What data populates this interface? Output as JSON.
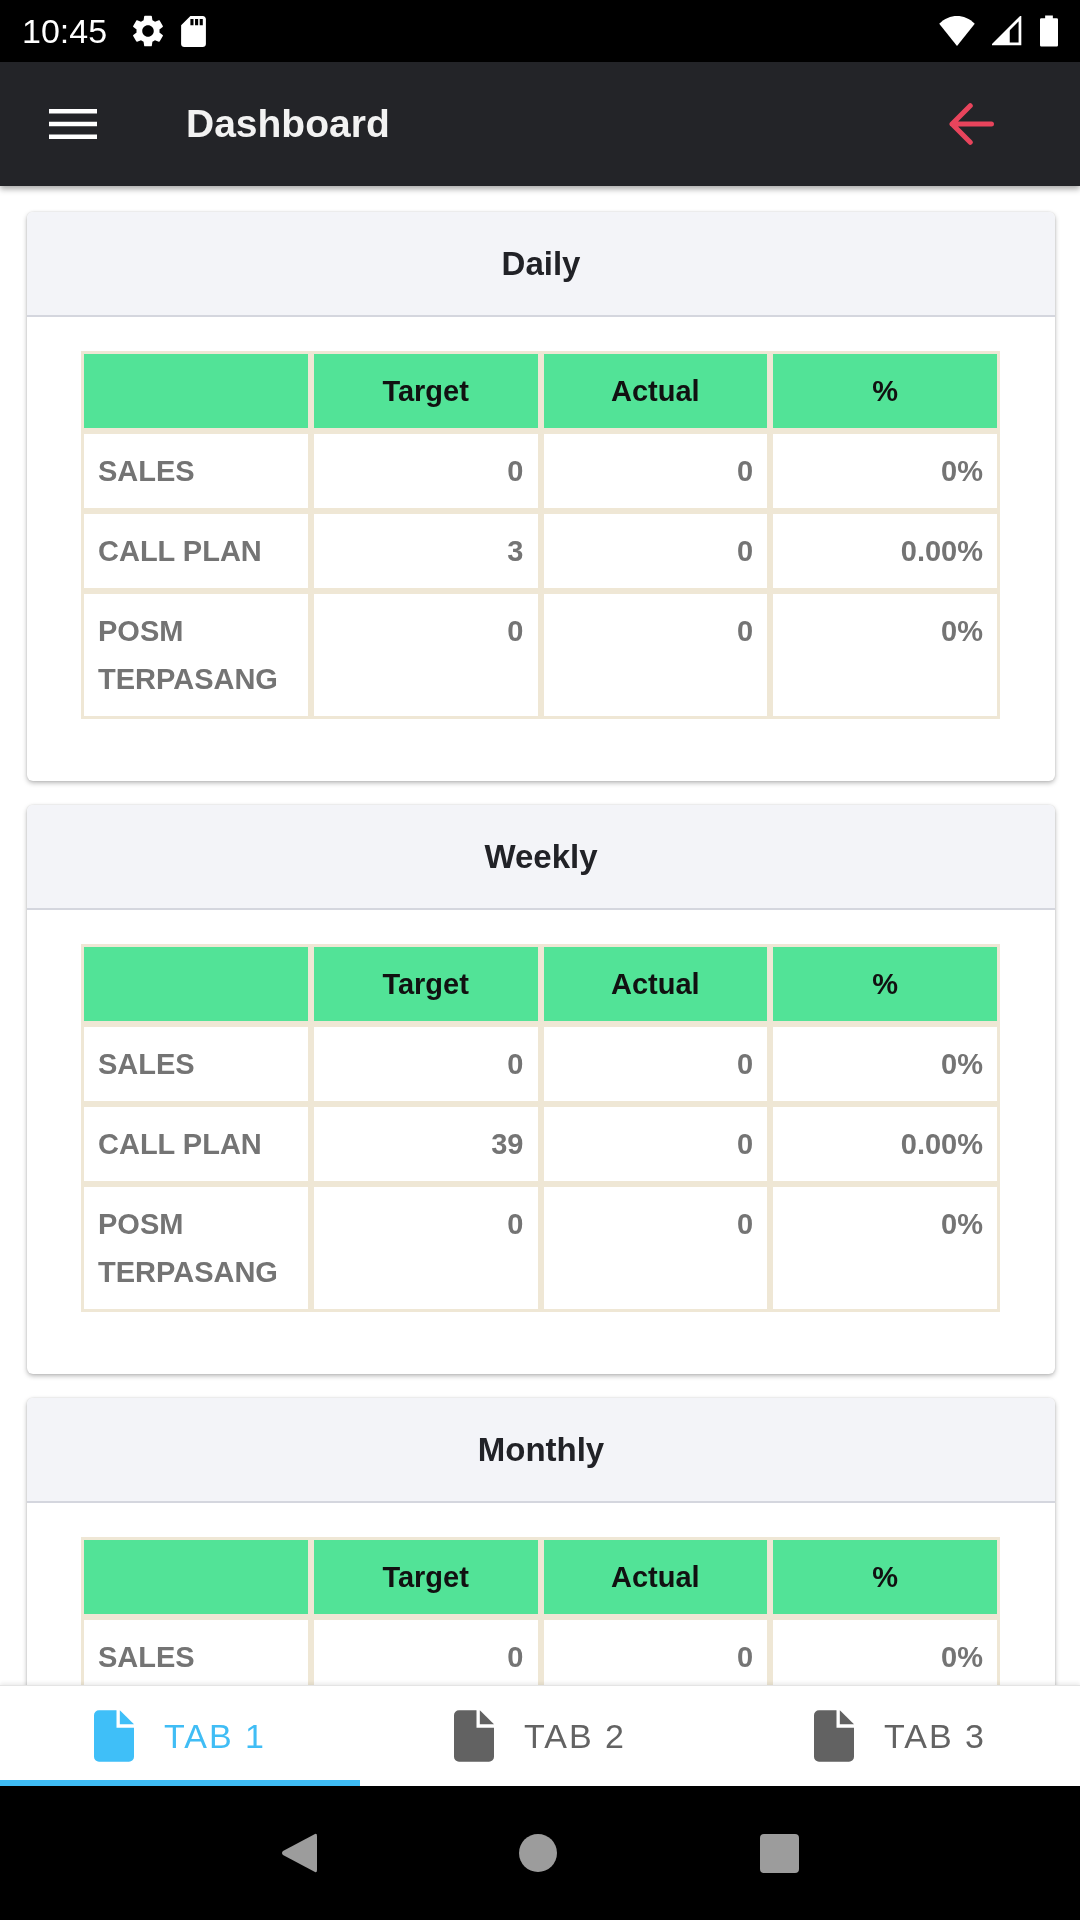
{
  "status_bar": {
    "time": "10:45"
  },
  "app_bar": {
    "title": "Dashboard"
  },
  "cards": [
    {
      "title": "Daily",
      "table": {
        "columns": [
          "Target",
          "Actual",
          "%"
        ],
        "rows": [
          {
            "label": "SALES",
            "target": "0",
            "actual": "0",
            "percent": "0%"
          },
          {
            "label": "CALL PLAN",
            "target": "3",
            "actual": "0",
            "percent": "0.00%"
          },
          {
            "label": "POSM TERPASANG",
            "target": "0",
            "actual": "0",
            "percent": "0%"
          }
        ]
      }
    },
    {
      "title": "Weekly",
      "table": {
        "columns": [
          "Target",
          "Actual",
          "%"
        ],
        "rows": [
          {
            "label": "SALES",
            "target": "0",
            "actual": "0",
            "percent": "0%"
          },
          {
            "label": "CALL PLAN",
            "target": "39",
            "actual": "0",
            "percent": "0.00%"
          },
          {
            "label": "POSM TERPASANG",
            "target": "0",
            "actual": "0",
            "percent": "0%"
          }
        ]
      }
    },
    {
      "title": "Monthly",
      "table": {
        "columns": [
          "Target",
          "Actual",
          "%"
        ],
        "rows": [
          {
            "label": "SALES",
            "target": "0",
            "actual": "0",
            "percent": "0%"
          }
        ]
      }
    }
  ],
  "tabs": [
    {
      "label": "TAB 1",
      "selected": true
    },
    {
      "label": "TAB 2",
      "selected": false
    },
    {
      "label": "TAB 3",
      "selected": false
    }
  ]
}
